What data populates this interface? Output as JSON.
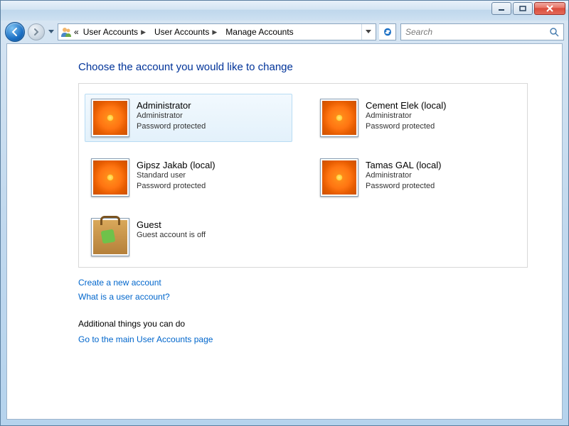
{
  "breadcrumb": {
    "prefix": "«",
    "items": [
      "User Accounts",
      "User Accounts",
      "Manage Accounts"
    ]
  },
  "search": {
    "placeholder": "Search"
  },
  "page": {
    "title": "Choose the account you would like to change"
  },
  "accounts": [
    {
      "name": "Administrator",
      "role": "Administrator",
      "pw": "Password protected",
      "pic": "flower",
      "selected": true
    },
    {
      "name": "Cement Elek (local)",
      "role": "Administrator",
      "pw": "Password protected",
      "pic": "flower",
      "selected": false
    },
    {
      "name": "Gipsz Jakab (local)",
      "role": "Standard user",
      "pw": "Password protected",
      "pic": "flower",
      "selected": false
    },
    {
      "name": "Tamas GAL (local)",
      "role": "Administrator",
      "pw": "Password protected",
      "pic": "flower",
      "selected": false
    },
    {
      "name": "Guest",
      "role": "Guest account is off",
      "pw": "",
      "pic": "suitcase",
      "selected": false
    }
  ],
  "links": {
    "create": "Create a new account",
    "whatis": "What is a user account?"
  },
  "additional": {
    "heading": "Additional things you can do",
    "main_page": "Go to the main User Accounts page"
  }
}
